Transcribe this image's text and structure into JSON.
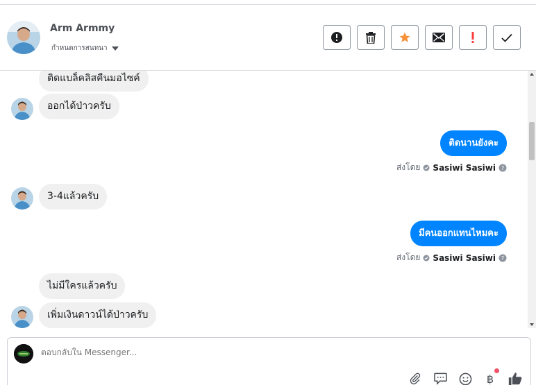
{
  "header": {
    "contact_name": "Arm Armmy",
    "assign_label": "กำหนดการสนทนา",
    "actions": [
      {
        "icon": "alert-circle-icon",
        "name": "spam-button"
      },
      {
        "icon": "trash-icon",
        "name": "delete-button"
      },
      {
        "icon": "star-icon",
        "name": "star-button"
      },
      {
        "icon": "envelope-icon",
        "name": "mark-unread-button"
      },
      {
        "icon": "exclamation-icon",
        "name": "follow-up-button"
      },
      {
        "icon": "check-icon",
        "name": "done-button"
      }
    ]
  },
  "messages": [
    {
      "type": "in",
      "text": "ติดแบล็คลิสคืนมอไซค์",
      "avatar": false
    },
    {
      "type": "in",
      "text": "ออกได้ป่าวครับ",
      "avatar": true
    },
    {
      "type": "out",
      "text": "ติดนานยังคะ",
      "sent_by_label": "ส่งโดย",
      "sender": "Sasiwi Sasiwi"
    },
    {
      "type": "in",
      "text": "3-4แล้วครับ",
      "avatar": true
    },
    {
      "type": "out",
      "text": "มีคนออกแทนไหมคะ",
      "sent_by_label": "ส่งโดย",
      "sender": "Sasiwi Sasiwi"
    },
    {
      "type": "in",
      "text": "ไม่มีใครแล้วครับ",
      "avatar": false
    },
    {
      "type": "in",
      "text": "เพิ่มเงินดาวน์ได้ป่าวครับ",
      "avatar": true
    }
  ],
  "composer": {
    "placeholder": "ตอบกลับใน Messenger...",
    "currency_symbol": "฿"
  },
  "colors": {
    "outgoing_bubble": "#0084ff",
    "incoming_bubble": "#f0f0f0",
    "star": "#f7923b",
    "exclamation": "#fa3e3e",
    "like": "#4b4f56"
  }
}
